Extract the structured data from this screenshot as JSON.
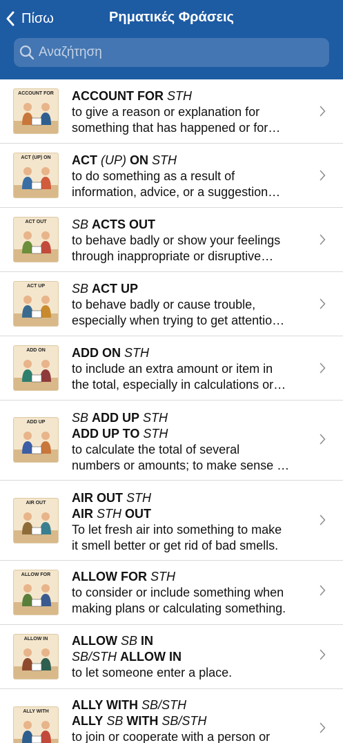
{
  "header": {
    "back_label": "Πίσω",
    "title": "Ρηματικές Φράσεις",
    "search_placeholder": "Αναζήτηση"
  },
  "entries": [
    {
      "thumb_caption": "ACCOUNT FOR",
      "heads": [
        [
          {
            "t": "ACCOUNT FOR",
            "s": "b"
          },
          {
            "t": " STH",
            "s": "i"
          }
        ]
      ],
      "definition": [
        "to give a reason or explanation for",
        "something that has happened or for…"
      ]
    },
    {
      "thumb_caption": "ACT (UP) ON",
      "heads": [
        [
          {
            "t": "ACT",
            "s": "b"
          },
          {
            "t": " (UP) ",
            "s": "i"
          },
          {
            "t": "ON",
            "s": "b"
          },
          {
            "t": " STH",
            "s": "i"
          }
        ]
      ],
      "definition": [
        "to do something as a result of",
        "information, advice, or a suggestion…"
      ]
    },
    {
      "thumb_caption": "ACT OUT",
      "heads": [
        [
          {
            "t": "SB ",
            "s": "i"
          },
          {
            "t": "ACTS OUT",
            "s": "b"
          }
        ]
      ],
      "definition": [
        "to behave badly or show your feelings",
        "through inappropriate or disruptive…"
      ]
    },
    {
      "thumb_caption": "ACT UP",
      "heads": [
        [
          {
            "t": "SB ",
            "s": "i"
          },
          {
            "t": "ACT UP",
            "s": "b"
          }
        ]
      ],
      "definition": [
        "to behave badly or cause trouble,",
        "especially when trying to get attentio…"
      ]
    },
    {
      "thumb_caption": "ADD ON",
      "heads": [
        [
          {
            "t": "ADD ON",
            "s": "b"
          },
          {
            "t": " STH",
            "s": "i"
          }
        ]
      ],
      "definition": [
        "to include an extra amount or item in",
        "the total, especially in calculations or…"
      ]
    },
    {
      "thumb_caption": "ADD UP",
      "heads": [
        [
          {
            "t": "SB ",
            "s": "i"
          },
          {
            "t": "ADD UP",
            "s": "b"
          },
          {
            "t": " STH",
            "s": "i"
          }
        ],
        [
          {
            "t": "ADD UP TO",
            "s": "b"
          },
          {
            "t": " STH",
            "s": "i"
          }
        ]
      ],
      "definition": [
        "to calculate the total of several",
        "numbers or amounts; to make sense …"
      ]
    },
    {
      "thumb_caption": "AIR OUT",
      "heads": [
        [
          {
            "t": "AIR OUT",
            "s": "b"
          },
          {
            "t": " STH",
            "s": "i"
          }
        ],
        [
          {
            "t": "AIR",
            "s": "b"
          },
          {
            "t": " STH ",
            "s": "i"
          },
          {
            "t": "OUT",
            "s": "b"
          }
        ]
      ],
      "definition": [
        "To let fresh air into something to make",
        "it smell better or get rid of bad smells."
      ]
    },
    {
      "thumb_caption": "ALLOW FOR",
      "heads": [
        [
          {
            "t": "ALLOW FOR",
            "s": "b"
          },
          {
            "t": " STH",
            "s": "i"
          }
        ]
      ],
      "definition": [
        "to consider or include something when",
        "making plans or calculating something."
      ]
    },
    {
      "thumb_caption": "ALLOW IN",
      "heads": [
        [
          {
            "t": "ALLOW",
            "s": "b"
          },
          {
            "t": " SB ",
            "s": "i"
          },
          {
            "t": "IN",
            "s": "b"
          }
        ],
        [
          {
            "t": "SB/STH ",
            "s": "i"
          },
          {
            "t": "ALLOW IN",
            "s": "b"
          }
        ]
      ],
      "definition": [
        "to let someone enter a place."
      ]
    },
    {
      "thumb_caption": "ALLY WITH",
      "heads": [
        [
          {
            "t": "ALLY WITH",
            "s": "b"
          },
          {
            "t": " SB/STH",
            "s": "i"
          }
        ],
        [
          {
            "t": "ALLY",
            "s": "b"
          },
          {
            "t": " SB ",
            "s": "i"
          },
          {
            "t": "WITH",
            "s": "b"
          },
          {
            "t": " SB/STH",
            "s": "i"
          }
        ]
      ],
      "definition": [
        "to join or cooperate with a person or"
      ]
    }
  ]
}
